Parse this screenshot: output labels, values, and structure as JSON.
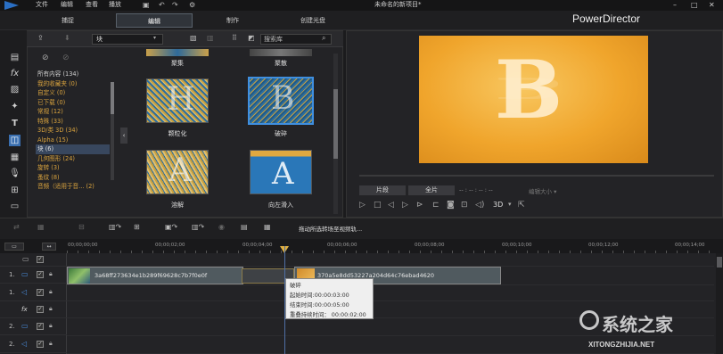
{
  "menu": [
    "文件",
    "编辑",
    "查看",
    "播放"
  ],
  "window_title": "未命名的新项目*",
  "brand": "PowerDirector",
  "mode_tabs": [
    {
      "label": "捕捉",
      "active": false
    },
    {
      "label": "编辑",
      "active": true
    },
    {
      "label": "制作",
      "active": false
    },
    {
      "label": "创建光盘",
      "active": false
    }
  ],
  "library": {
    "category_select": "块",
    "search_placeholder": "搜索库",
    "categories": [
      {
        "label": "所有内容 (134)"
      },
      {
        "label": "我的收藏夹 (0)"
      },
      {
        "label": "自定义 (0)"
      },
      {
        "label": "已下载 (0)"
      },
      {
        "label": "常规 (12)"
      },
      {
        "label": "特殊 (33)"
      },
      {
        "label": "3D/类 3D (34)"
      },
      {
        "label": "Alpha (15)"
      },
      {
        "label": "块 (6)"
      },
      {
        "label": "几何图形 (24)"
      },
      {
        "label": "旋转 (3)"
      },
      {
        "label": "蚤纹 (8)"
      },
      {
        "label": "音频（适用于音... (2)"
      }
    ],
    "thumbnails": [
      {
        "label": "聚集",
        "selected": false
      },
      {
        "label": "聚散",
        "selected": false
      },
      {
        "label": "颗粒化",
        "letter": "H",
        "selected": false
      },
      {
        "label": "破碎",
        "letter": "B",
        "selected": true
      },
      {
        "label": "溶解",
        "letter": "A",
        "selected": false
      },
      {
        "label": "向左滑入",
        "letter": "A",
        "selected": false
      }
    ]
  },
  "preview": {
    "letter": "B",
    "clip_button": "片段",
    "movie_button": "全片",
    "timecode": "-- : -- : -- : --",
    "timecode_dim": "编辑大小 ▾",
    "d3_label": "3D"
  },
  "timeline": {
    "hint": "拖动所选转场至视频轨...",
    "ruler_ticks": [
      "00;00;00;00",
      "00;00;02;00",
      "00;00;04;00",
      "00;00;06;00",
      "00;00;08;00",
      "00;00;10;00",
      "00;00;12;00",
      "00;00;14;00"
    ],
    "tracks": [
      {
        "label": "1."
      },
      {
        "label": "1."
      },
      {
        "label": "fx"
      },
      {
        "label": "2."
      },
      {
        "label": "2."
      }
    ],
    "clip1_name": "3a68ff273634e1b289f69628c7b7f0e0f",
    "clip2_name": "370a5e8dd53227a204d64c76ebad4620",
    "tooltip": {
      "title": "破碎",
      "start": "起始时间:00:00:03:00",
      "end": "结束时间:00:00:05:00",
      "overlap": "重叠持续时间：  00:00:02:00"
    }
  },
  "watermark": {
    "line1": "系统之家",
    "line2": "XITONGZHIJIA.NET"
  }
}
